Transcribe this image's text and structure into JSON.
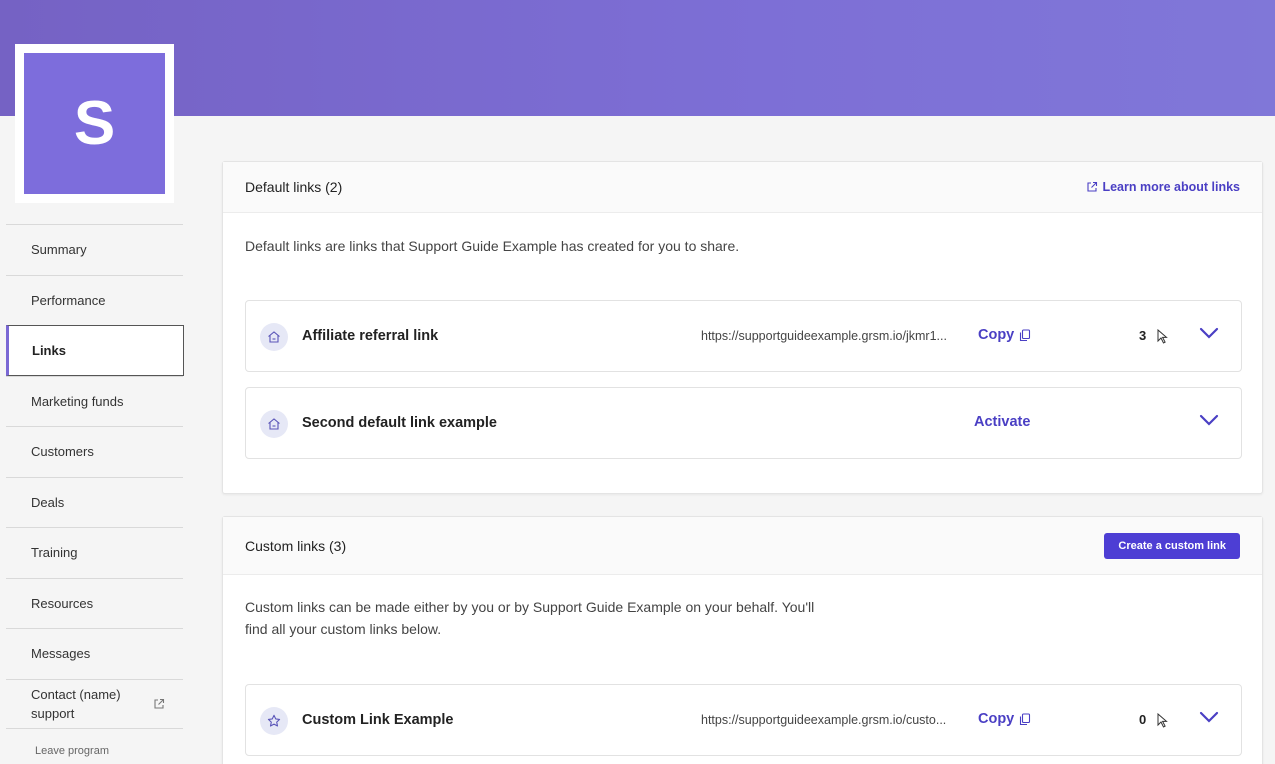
{
  "avatar": {
    "letter": "S"
  },
  "sidebar": {
    "items": [
      {
        "label": "Summary"
      },
      {
        "label": "Performance"
      },
      {
        "label": "Links"
      },
      {
        "label": "Marketing funds"
      },
      {
        "label": "Customers"
      },
      {
        "label": "Deals"
      },
      {
        "label": "Training"
      },
      {
        "label": "Resources"
      },
      {
        "label": "Messages"
      }
    ],
    "contact_line1": "Contact (name)",
    "contact_line2": "support",
    "leave": "Leave program"
  },
  "default_links": {
    "title": "Default links (2)",
    "learn_more": "Learn more about links",
    "description": "Default links are links that Support Guide Example has created for you to share.",
    "rows": [
      {
        "name": "Affiliate referral link",
        "url": "https://supportguideexample.grsm.io/jkmr1...",
        "copy": "Copy",
        "count": "3"
      },
      {
        "name": "Second default link example",
        "action": "Activate"
      }
    ]
  },
  "custom_links": {
    "title": "Custom links (3)",
    "create_button": "Create a custom link",
    "description_line1": "Custom links can be made either by you or by Support Guide Example on your behalf. You'll",
    "description_line2": "find all your custom links below.",
    "rows": [
      {
        "name": "Custom Link Example",
        "url": "https://supportguideexample.grsm.io/custo...",
        "copy": "Copy",
        "count": "0"
      }
    ]
  },
  "colors": {
    "accent": "#4a3fc4",
    "banner": "#7a68d4",
    "button": "#4d3ed4"
  }
}
